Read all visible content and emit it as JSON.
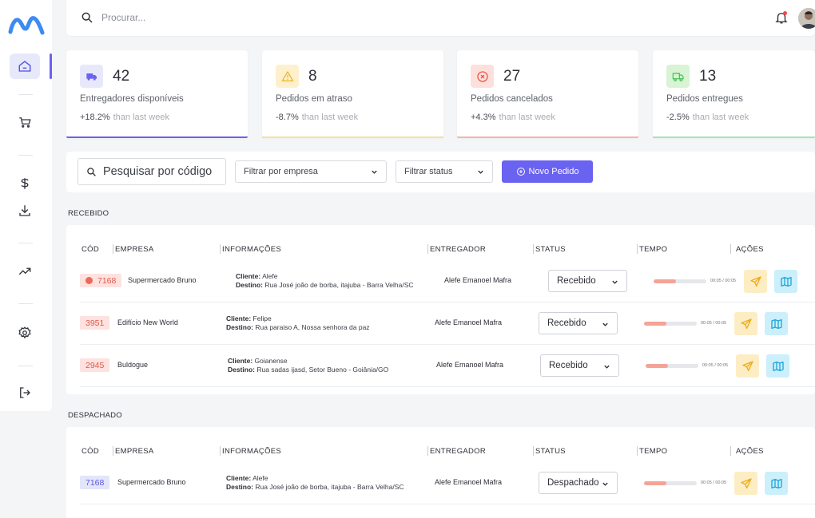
{
  "search": {
    "placeholder": "Procurar..."
  },
  "stats": [
    {
      "value": "42",
      "label": "Entregadores disponíveis",
      "change": "+18.2%",
      "suffix": "than last week",
      "icon": "truck-icon",
      "color": "#6a62f0",
      "bg": "#e7e9fb"
    },
    {
      "value": "8",
      "label": "Pedidos em atraso",
      "change": "-8.7%",
      "suffix": "than last week",
      "icon": "warning-icon",
      "color": "#f1b82c",
      "bg": "#fdf0cc"
    },
    {
      "value": "27",
      "label": "Pedidos cancelados",
      "change": "+4.3%",
      "suffix": "than last week",
      "icon": "cancel-icon",
      "color": "#e8594a",
      "bg": "#fde0dc"
    },
    {
      "value": "13",
      "label": "Pedidos entregues",
      "change": "-2.5%",
      "suffix": "than last week",
      "icon": "delivery-truck-icon",
      "color": "#43c24f",
      "bg": "#d9f3d5"
    }
  ],
  "filters": {
    "code_search": "Pesquisar por código",
    "company": "Filtrar por empresa",
    "status": "Filtrar status",
    "new_order": "Novo Pedido"
  },
  "columns": {
    "code": "CÓD",
    "company": "EMPRESA",
    "info": "INFORMAÇÕES",
    "courier": "ENTREGADOR",
    "status": "STATUS",
    "time": "TEMPO",
    "actions": "AÇÕES"
  },
  "info_labels": {
    "client": "Cliente:",
    "destination": "Destino:"
  },
  "sections": [
    {
      "title": "RECEBIDO",
      "rows": [
        {
          "code": "7168",
          "company": "Supermercado Bruno",
          "client": "Alefe",
          "destination": "Rua José joão de borba, itajuba - Barra Velha/SC",
          "courier": "Alefe Emanoel Mafra",
          "status": "Recebido",
          "progress": 0.42,
          "time": "00:05 / 00:05",
          "alert": true
        },
        {
          "code": "3951",
          "company": "Edifício New World",
          "client": "Felipe",
          "destination": "Rua paraiso A, Nossa senhora da paz",
          "courier": "Alefe Emanoel Mafra",
          "status": "Recebido",
          "progress": 0.42,
          "time": "00:05 / 00:05",
          "alert": false
        },
        {
          "code": "2945",
          "company": "Buldogue",
          "client": "Goianense",
          "destination": "Rua sadas ijasd, Setor Bueno - Goiânia/GO",
          "courier": "Alefe Emanoel Mafra",
          "status": "Recebido",
          "progress": 0.42,
          "time": "00:05 / 00:05",
          "alert": false
        }
      ]
    },
    {
      "title": "DESPACHADO",
      "rows": [
        {
          "code": "7168",
          "company": "Supermercado Bruno",
          "client": "Alefe",
          "destination": "Rua José joão de borba, itajuba - Barra Velha/SC",
          "courier": "Alefe Emanoel Mafra",
          "status": "Despachado",
          "progress": 0.42,
          "time": "00:05 / 00:05",
          "alert": false
        }
      ]
    }
  ]
}
